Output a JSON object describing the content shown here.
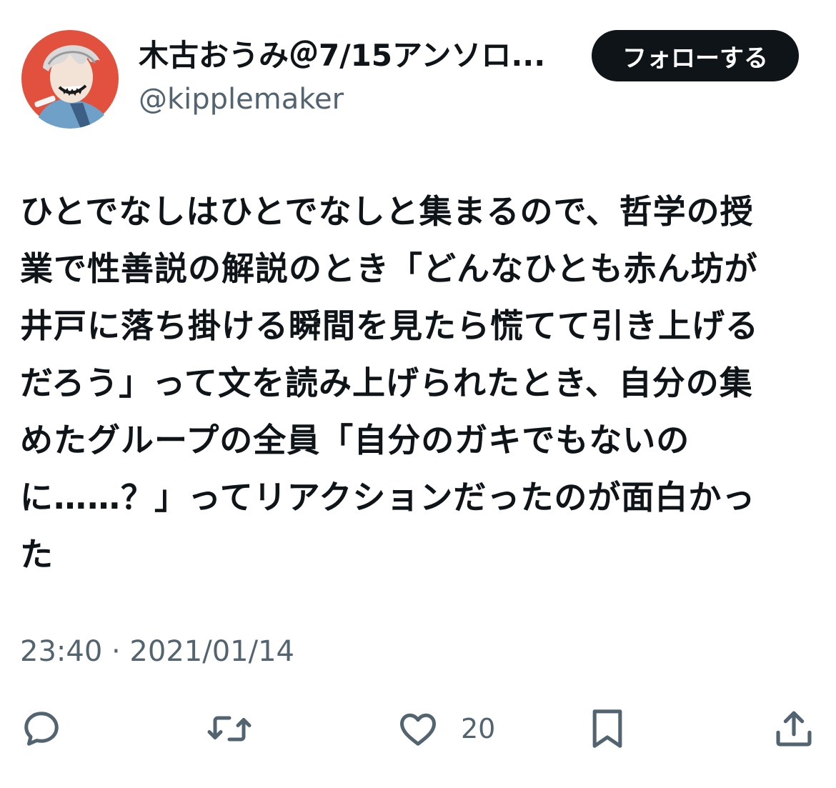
{
  "author": {
    "display_name": "木古おうみ＠7/15アンソロ...",
    "handle": "@kipplemaker",
    "avatar_icon": "avatar-icon"
  },
  "follow_button": {
    "label": "フォローする"
  },
  "tweet": {
    "lines": [
      "ひとでなしはひとでなしと集まるので、哲学の授",
      "業で性善説の解説のとき「どんなひとも赤ん坊が",
      "井戸に落ち掛ける瞬間を見たら慌てて引き上げる",
      "だろう」って文を読み上げられたとき、自分の集",
      "めたグループの全員「自分のガキでもないの",
      "に……？」ってリアクションだったのが面白かっ",
      "た"
    ]
  },
  "meta": {
    "timestamp": "23:40 · 2021/01/14"
  },
  "actions": {
    "reply_icon": "reply-icon",
    "retweet_icon": "retweet-icon",
    "like_icon": "heart-icon",
    "like_count": "20",
    "bookmark_icon": "bookmark-icon",
    "share_icon": "share-icon"
  },
  "colors": {
    "text_primary": "#0f1419",
    "text_secondary": "#536471",
    "follow_bg": "#0f1419",
    "avatar_bg": "#e2513d"
  }
}
